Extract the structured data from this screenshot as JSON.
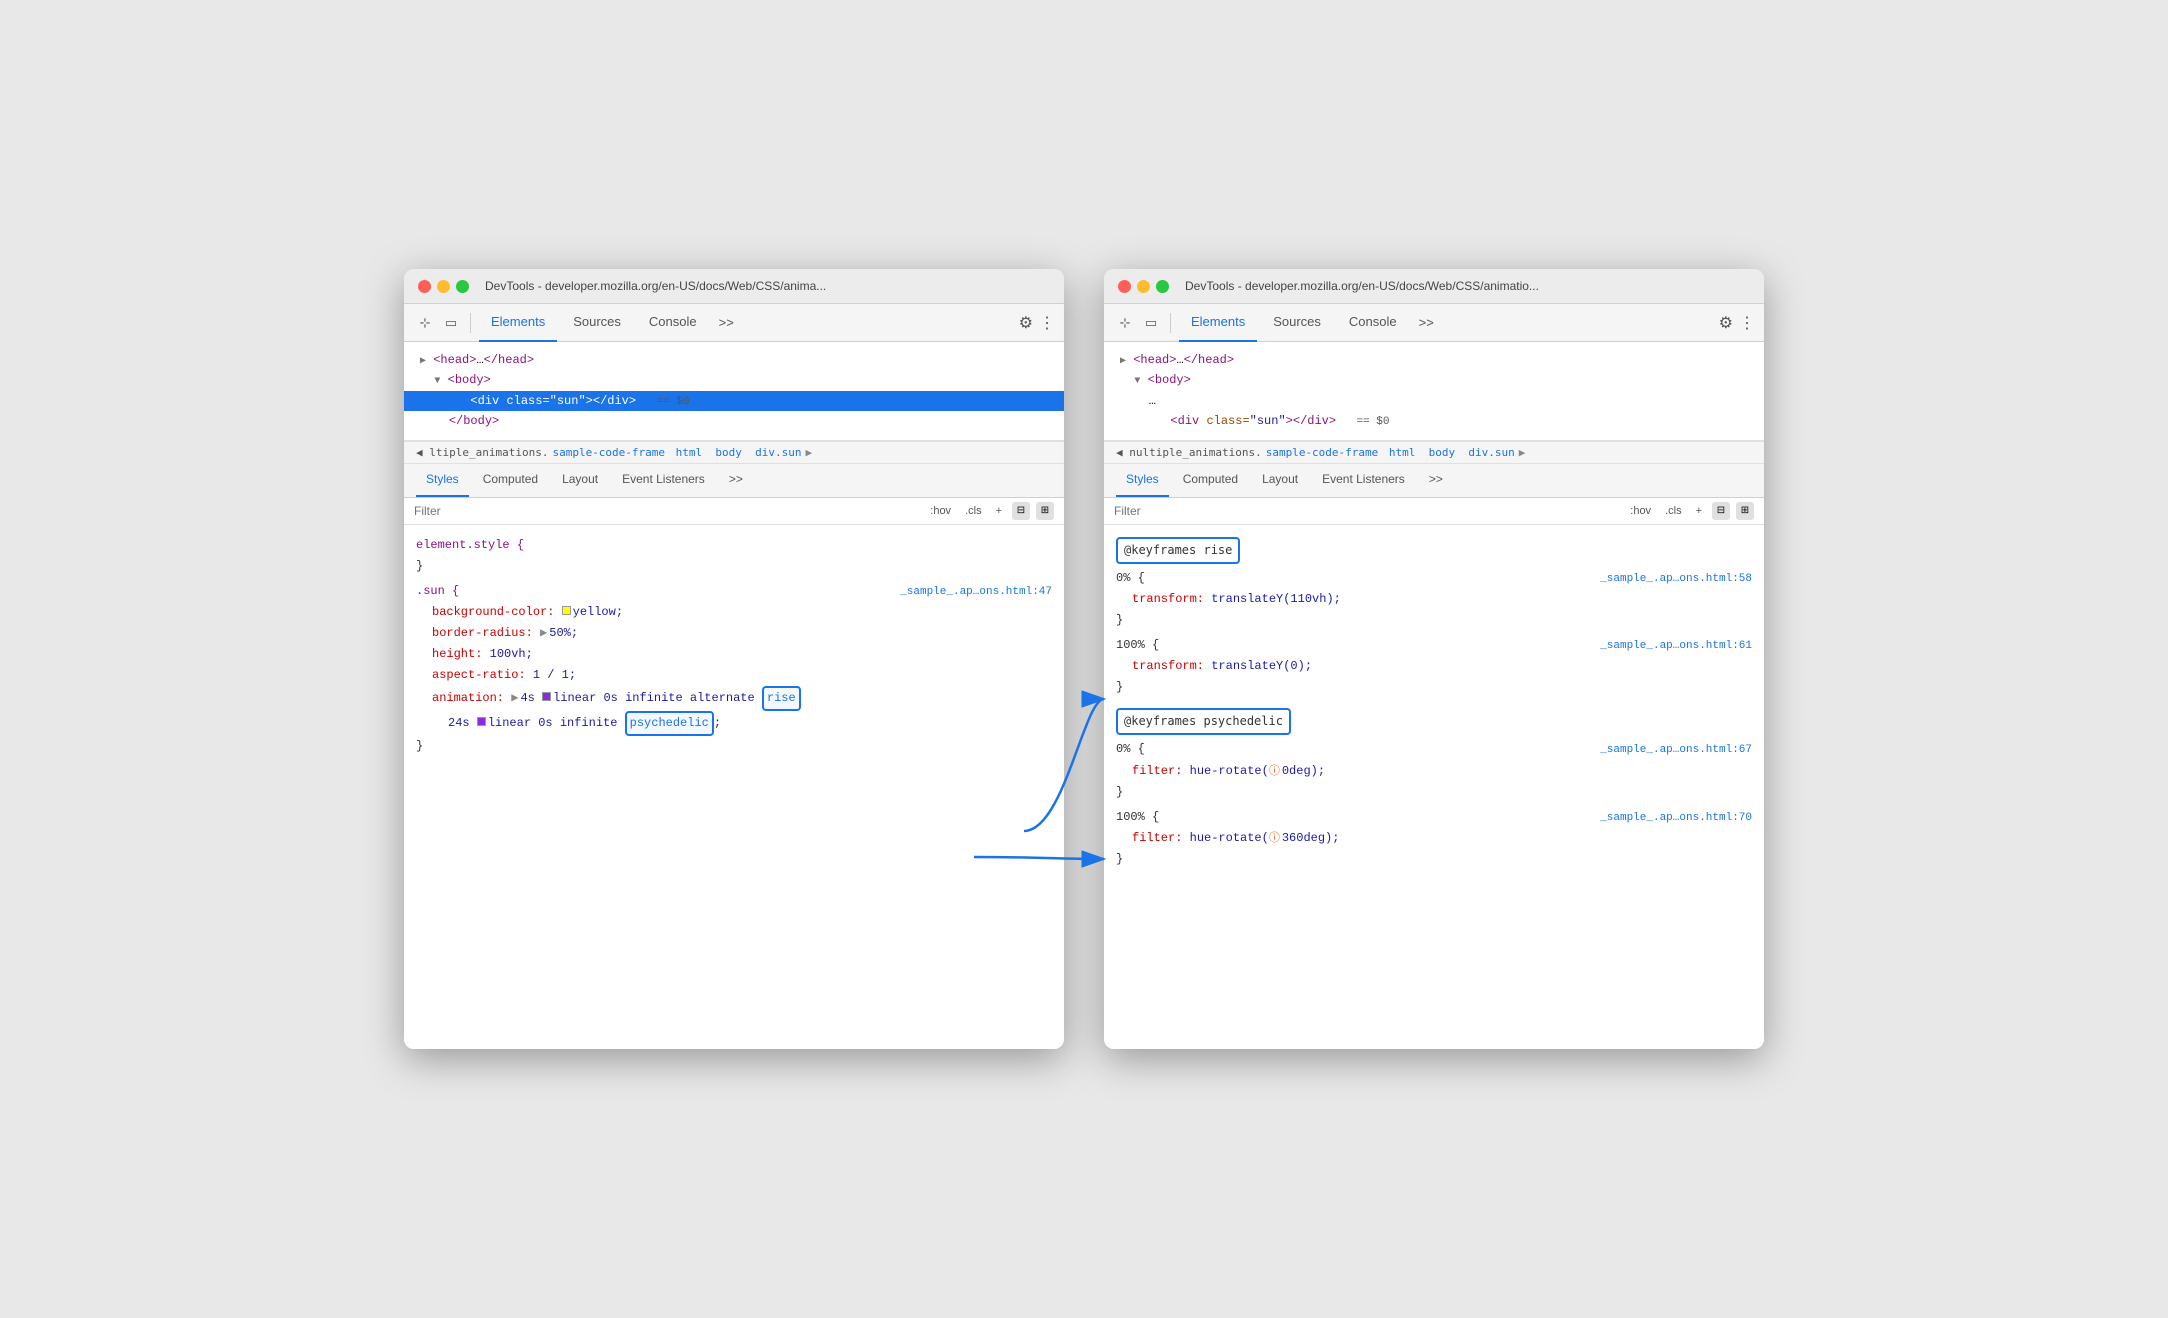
{
  "window1": {
    "title": "DevTools - developer.mozilla.org/en-US/docs/Web/CSS/anima...",
    "tabs": [
      "Elements",
      "Sources",
      "Console",
      ">>"
    ],
    "active_tab": "Elements",
    "sub_tabs": [
      "Styles",
      "Computed",
      "Layout",
      "Event Listeners",
      ">>"
    ],
    "active_sub_tab": "Styles",
    "html_tree": [
      {
        "text": "▶ <head>…</head>",
        "indent": 1
      },
      {
        "text": "▼ <body>",
        "indent": 1
      },
      {
        "text": "<div class=\"sun\"></div>  == $0",
        "indent": 3,
        "selected": true
      },
      {
        "text": "</body>",
        "indent": 2
      }
    ],
    "breadcrumb": {
      "prefix": "◀ ltiple_animations.",
      "link": "sample-code-frame",
      "items": [
        "html",
        "body",
        "div.sun"
      ],
      "arrow": "▶"
    },
    "filter_placeholder": "Filter",
    "filter_hov": ":hov",
    "filter_cls": ".cls",
    "css_rules": [
      {
        "selector": "element.style {",
        "close": "}",
        "properties": []
      },
      {
        "selector": ".sun {",
        "source": "_sample_.ap…ons.html:47",
        "close": "}",
        "properties": [
          {
            "prop": "background-color:",
            "value": "yellow;",
            "swatch": "yellow"
          },
          {
            "prop": "border-radius:",
            "value": "▶ 50%;",
            "arrow": true
          },
          {
            "prop": "height:",
            "value": "100vh;"
          },
          {
            "prop": "aspect-ratio:",
            "value": "1 / 1;"
          },
          {
            "prop": "animation:",
            "value": "▶ 4s 🟪 linear 0s infinite alternate",
            "keyword": "rise",
            "keyword_class": "rise"
          },
          {
            "prop": "",
            "value": "24s 🟪 linear 0s infinite",
            "keyword": "psychedelic",
            "keyword_class": "psychedelic",
            "semicolon": ";"
          }
        ]
      }
    ]
  },
  "window2": {
    "title": "DevTools - developer.mozilla.org/en-US/docs/Web/CSS/animatio...",
    "tabs": [
      "Elements",
      "Sources",
      "Console",
      ">>"
    ],
    "active_tab": "Elements",
    "sub_tabs": [
      "Styles",
      "Computed",
      "Layout",
      "Event Listeners",
      ">>"
    ],
    "active_sub_tab": "Styles",
    "html_tree": [
      {
        "text": "▶ <head>…</head>",
        "indent": 1
      },
      {
        "text": "▼ <body>",
        "indent": 1
      },
      {
        "text": "…",
        "indent": 2
      },
      {
        "text": "<div class=\"sun\"></div>  == $0",
        "indent": 3
      }
    ],
    "breadcrumb": {
      "prefix": "◀ nultiple_animations.",
      "link": "sample-code-frame",
      "items": [
        "html",
        "body",
        "div.sun"
      ],
      "arrow": "▶"
    },
    "filter_placeholder": "Filter",
    "filter_hov": ":hov",
    "filter_cls": ".cls",
    "keyframe_rules": [
      {
        "name": "@keyframes rise",
        "source_header": "",
        "steps": [
          {
            "selector": "0% {",
            "source": "_sample_.ap…ons.html:58",
            "close": "}",
            "properties": [
              {
                "prop": "transform:",
                "value": "translateY(110vh);"
              }
            ]
          },
          {
            "selector": "100% {",
            "source": "_sample_.ap…ons.html:61",
            "close": "}",
            "properties": [
              {
                "prop": "transform:",
                "value": "translateY(0);"
              }
            ]
          }
        ]
      },
      {
        "name": "@keyframes psychedelic",
        "steps": [
          {
            "selector": "0% {",
            "source": "_sample_.ap…ons.html:67",
            "close": "}",
            "properties": [
              {
                "prop": "filter:",
                "value": "hue-rotate(⚠0deg);"
              }
            ]
          },
          {
            "selector": "100% {",
            "source": "_sample_.ap…ons.html:70",
            "close": "}",
            "properties": [
              {
                "prop": "filter:",
                "value": "hue-rotate(⚠360deg);"
              }
            ]
          }
        ]
      }
    ]
  },
  "labels": {
    "filter": "Filter",
    "hov": ":hov",
    "cls": ".cls"
  }
}
